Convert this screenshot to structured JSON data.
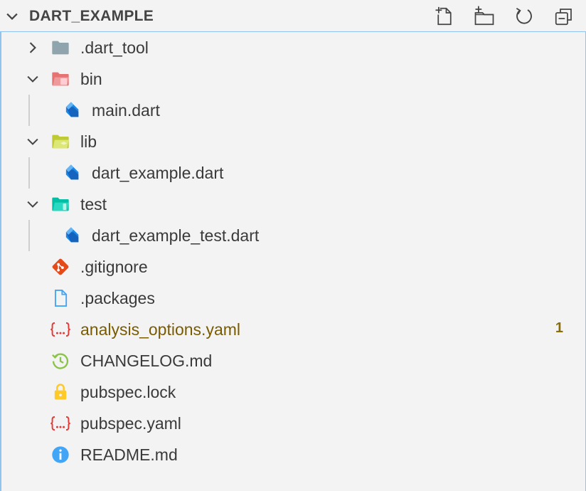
{
  "explorer": {
    "title": "DART_EXAMPLE",
    "actions": [
      {
        "name": "new-file",
        "icon": "new-file-icon"
      },
      {
        "name": "new-folder",
        "icon": "new-folder-icon"
      },
      {
        "name": "refresh",
        "icon": "refresh-icon"
      },
      {
        "name": "collapse-all",
        "icon": "collapse-all-icon"
      }
    ]
  },
  "tree": {
    "items": [
      {
        "label": ".dart_tool",
        "type": "folder",
        "expanded": false,
        "icon": "folder-icon"
      },
      {
        "label": "bin",
        "type": "folder",
        "expanded": true,
        "icon": "folder-bin-icon"
      },
      {
        "label": "main.dart",
        "type": "file",
        "icon": "dart-icon"
      },
      {
        "label": "lib",
        "type": "folder",
        "expanded": true,
        "icon": "folder-lib-icon"
      },
      {
        "label": "dart_example.dart",
        "type": "file",
        "icon": "dart-icon"
      },
      {
        "label": "test",
        "type": "folder",
        "expanded": true,
        "icon": "folder-test-icon"
      },
      {
        "label": "dart_example_test.dart",
        "type": "file",
        "icon": "dart-icon"
      },
      {
        "label": ".gitignore",
        "type": "file",
        "icon": "git-icon"
      },
      {
        "label": ".packages",
        "type": "file",
        "icon": "file-icon"
      },
      {
        "label": "analysis_options.yaml",
        "type": "file",
        "icon": "yaml-icon",
        "badge": "1",
        "status": "warning"
      },
      {
        "label": "CHANGELOG.md",
        "type": "file",
        "icon": "changelog-icon"
      },
      {
        "label": "pubspec.lock",
        "type": "file",
        "icon": "lock-icon"
      },
      {
        "label": "pubspec.yaml",
        "type": "file",
        "icon": "yaml-icon"
      },
      {
        "label": "README.md",
        "type": "file",
        "icon": "info-icon"
      }
    ]
  },
  "colors": {
    "background": "#f3f3f3",
    "focus_border": "#90c3ee",
    "warning_text": "#7a5b00",
    "badge": "#8a6d0b"
  }
}
